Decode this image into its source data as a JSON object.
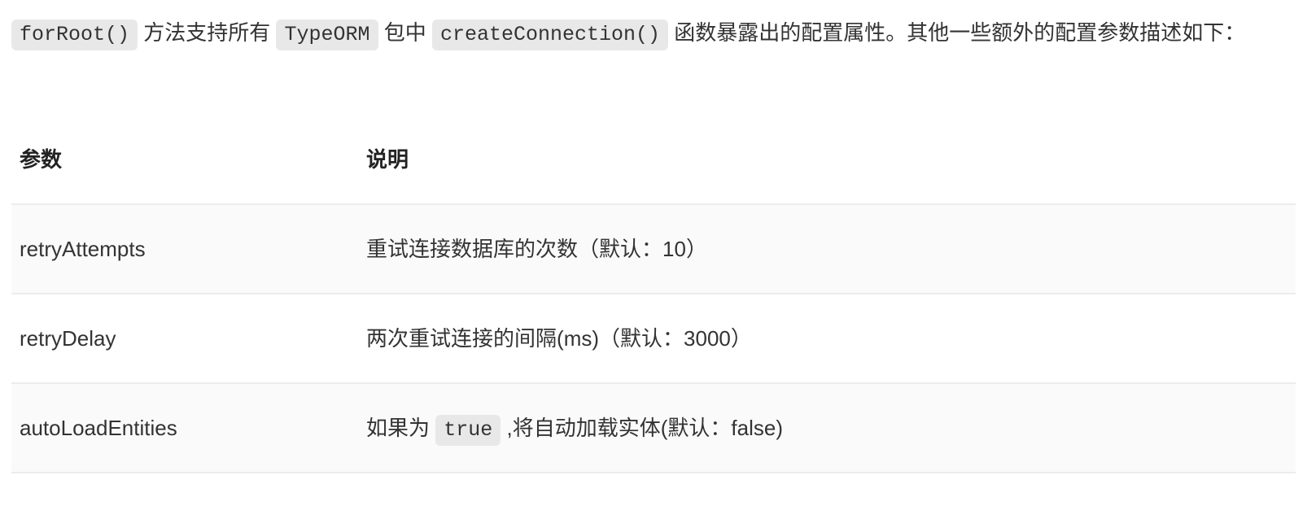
{
  "intro": {
    "code1": "forRoot()",
    "text1": " 方法支持所有 ",
    "code2": "TypeORM",
    "text2": " 包中 ",
    "code3": "createConnection()",
    "text3": " 函数暴露出的配置属性。其他一些额外的配置参数描述如下："
  },
  "table": {
    "headers": {
      "param": "参数",
      "desc": "说明"
    },
    "rows": [
      {
        "param": "retryAttempts",
        "desc_pre": "重试连接数据库的次数（默认：10）",
        "code": "",
        "desc_post": ""
      },
      {
        "param": "retryDelay",
        "desc_pre": "两次重试连接的间隔(ms)（默认：3000）",
        "code": "",
        "desc_post": ""
      },
      {
        "param": "autoLoadEntities",
        "desc_pre": "如果为 ",
        "code": "true",
        "desc_post": " ,将自动加载实体(默认：false)"
      }
    ]
  }
}
